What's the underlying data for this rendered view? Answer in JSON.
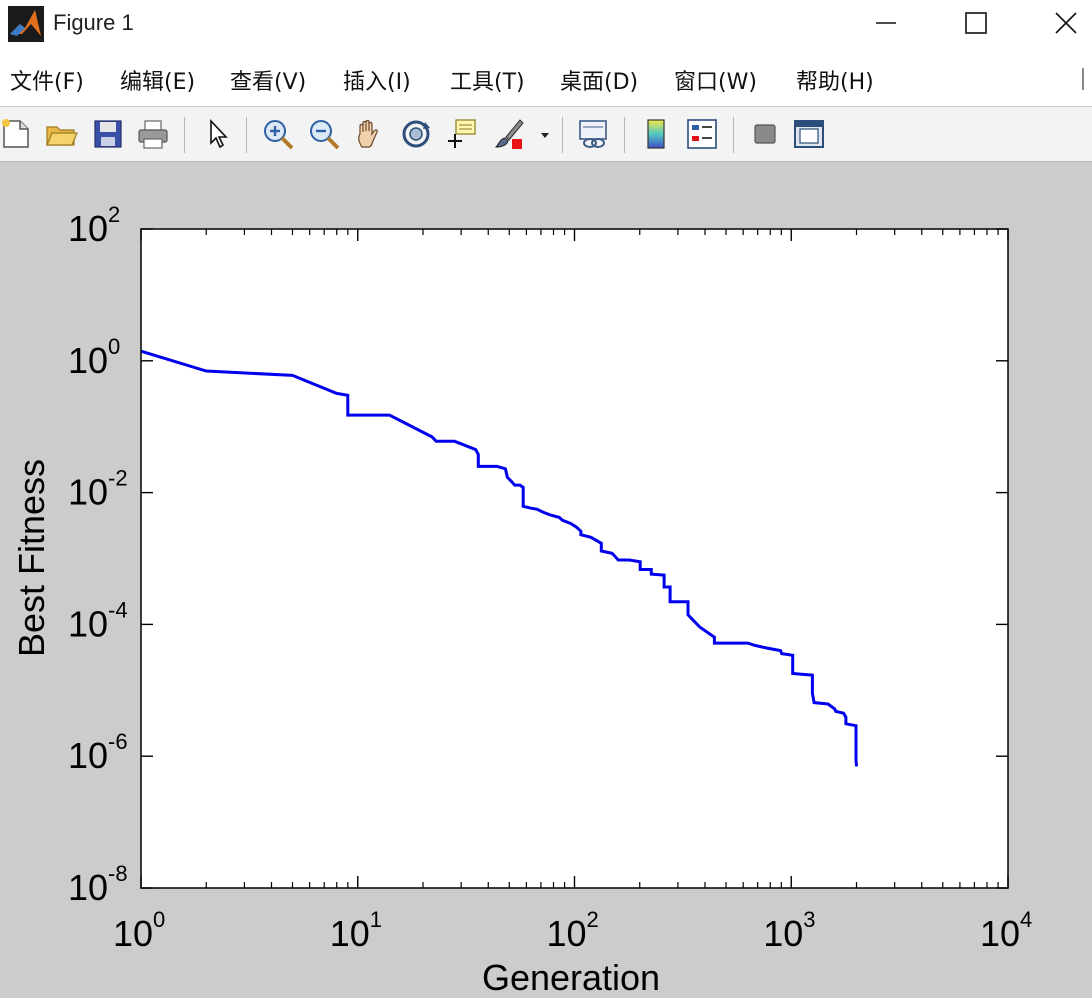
{
  "window": {
    "title": "Figure 1",
    "minimize_icon": "minimize-icon",
    "maximize_icon": "maximize-icon",
    "close_icon": "close-icon"
  },
  "menu": {
    "items": [
      {
        "label": "文件(F)"
      },
      {
        "label": "编辑(E)"
      },
      {
        "label": "查看(V)"
      },
      {
        "label": "插入(I)"
      },
      {
        "label": "工具(T)"
      },
      {
        "label": "桌面(D)"
      },
      {
        "label": "窗口(W)"
      },
      {
        "label": "帮助(H)"
      }
    ]
  },
  "toolbar": {
    "buttons": [
      {
        "icon": "new-figure-icon"
      },
      {
        "icon": "open-file-icon"
      },
      {
        "icon": "save-icon"
      },
      {
        "icon": "print-icon"
      },
      {
        "icon": "pointer-icon"
      },
      {
        "icon": "zoom-in-icon"
      },
      {
        "icon": "zoom-out-icon"
      },
      {
        "icon": "pan-icon"
      },
      {
        "icon": "rotate-3d-icon"
      },
      {
        "icon": "data-cursor-icon"
      },
      {
        "icon": "brush-icon"
      },
      {
        "icon": "link-plot-icon"
      },
      {
        "icon": "colorbar-icon"
      },
      {
        "icon": "legend-icon"
      },
      {
        "icon": "hide-plot-tools-icon"
      },
      {
        "icon": "show-plot-tools-icon"
      }
    ]
  },
  "colors": {
    "line": "#0000ee",
    "figure_bg": "#cccccc",
    "axes_bg": "#ffffff"
  },
  "chart_data": {
    "type": "line",
    "xlabel": "Generation",
    "ylabel": "Best Fitness",
    "xscale": "log",
    "yscale": "log",
    "xlim": [
      1,
      10000
    ],
    "ylim": [
      1e-08,
      100
    ],
    "xticks": [
      {
        "base": "10",
        "exp": "0"
      },
      {
        "base": "10",
        "exp": "1"
      },
      {
        "base": "10",
        "exp": "2"
      },
      {
        "base": "10",
        "exp": "3"
      },
      {
        "base": "10",
        "exp": "4"
      }
    ],
    "yticks": [
      {
        "base": "10",
        "exp": "-8"
      },
      {
        "base": "10",
        "exp": "-6"
      },
      {
        "base": "10",
        "exp": "-4"
      },
      {
        "base": "10",
        "exp": "-2"
      },
      {
        "base": "10",
        "exp": "0"
      },
      {
        "base": "10",
        "exp": "2"
      }
    ],
    "grid": false,
    "series": [
      {
        "x": [
          1,
          2,
          2,
          5,
          5,
          8,
          8,
          9,
          9,
          14,
          16,
          16,
          22,
          22,
          23,
          28,
          35,
          36,
          36,
          44,
          48,
          49,
          51,
          53,
          56,
          58,
          58,
          63,
          67,
          72,
          77,
          85,
          88,
          96,
          102,
          107,
          107,
          119,
          133,
          133,
          149,
          153,
          159,
          179,
          201,
          201,
          226,
          226,
          259,
          259,
          276,
          276,
          334,
          334,
          358,
          380,
          442,
          442,
          630,
          680,
          765,
          892,
          904,
          1016,
          1016,
          1252,
          1252,
          1275,
          1478,
          1588,
          1604,
          1743,
          1787,
          1787,
          1989,
          1990,
          1998,
          2000
        ],
        "y": [
          1.4,
          0.7,
          0.7,
          0.6,
          0.6,
          0.32,
          0.32,
          0.3,
          0.15,
          0.15,
          0.12,
          0.12,
          0.07,
          0.07,
          0.06,
          0.06,
          0.045,
          0.038,
          0.025,
          0.025,
          0.023,
          0.017,
          0.015,
          0.013,
          0.013,
          0.012,
          0.0062,
          0.0058,
          0.0056,
          0.005,
          0.0046,
          0.0042,
          0.0038,
          0.0034,
          0.003,
          0.0026,
          0.0023,
          0.0021,
          0.0017,
          0.0013,
          0.0012,
          0.0011,
          0.00095,
          0.00095,
          0.00089,
          0.00068,
          0.00068,
          0.00058,
          0.00056,
          0.00037,
          0.00037,
          0.00022,
          0.00022,
          0.00014,
          0.00011,
          9e-05,
          6.4e-05,
          5.2e-05,
          5.2e-05,
          4.8e-05,
          4.4e-05,
          4e-05,
          3.6e-05,
          3.4e-05,
          1.8e-05,
          1.7e-05,
          9e-06,
          6.5e-06,
          6.2e-06,
          5.2e-06,
          4.8e-06,
          4.5e-06,
          3.9e-06,
          3.1e-06,
          2.9e-06,
          8.5e-07,
          7.5e-07,
          7e-07
        ]
      }
    ]
  }
}
